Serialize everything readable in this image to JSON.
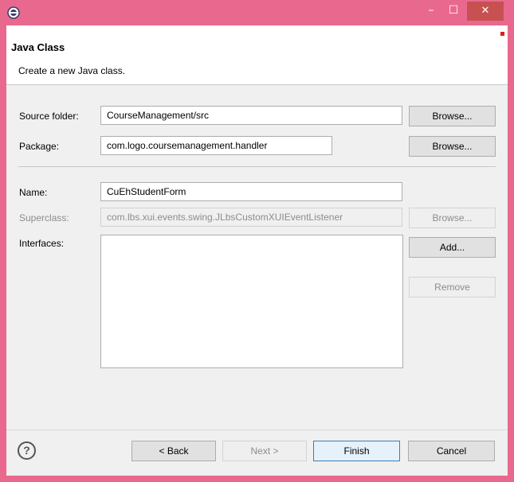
{
  "window": {
    "min_glyph": "–",
    "max_glyph": "☐",
    "close_glyph": "✕"
  },
  "header": {
    "title": "Java Class",
    "description": "Create a new Java class."
  },
  "form": {
    "source_folder_label": "Source folder:",
    "source_folder_value": "CourseManagement/src",
    "package_label": "Package:",
    "package_value": "com.logo.coursemanagement.handler",
    "browse_label": "Browse...",
    "name_label": "Name:",
    "name_value": "CuEhStudentForm",
    "superclass_label": "Superclass:",
    "superclass_value": "com.lbs.xui.events.swing.JLbsCustomXUIEventListener",
    "interfaces_label": "Interfaces:",
    "add_label": "Add...",
    "remove_label": "Remove"
  },
  "footer": {
    "help_glyph": "?",
    "back_label": "< Back",
    "next_label": "Next >",
    "finish_label": "Finish",
    "cancel_label": "Cancel"
  },
  "colors": {
    "title_bar": "#e9698e",
    "close_button": "#c75050",
    "header_bg": "#ffffff",
    "client_bg": "#f0f0f0"
  },
  "icons": [
    "eclipse-app-icon",
    "help-icon"
  ]
}
